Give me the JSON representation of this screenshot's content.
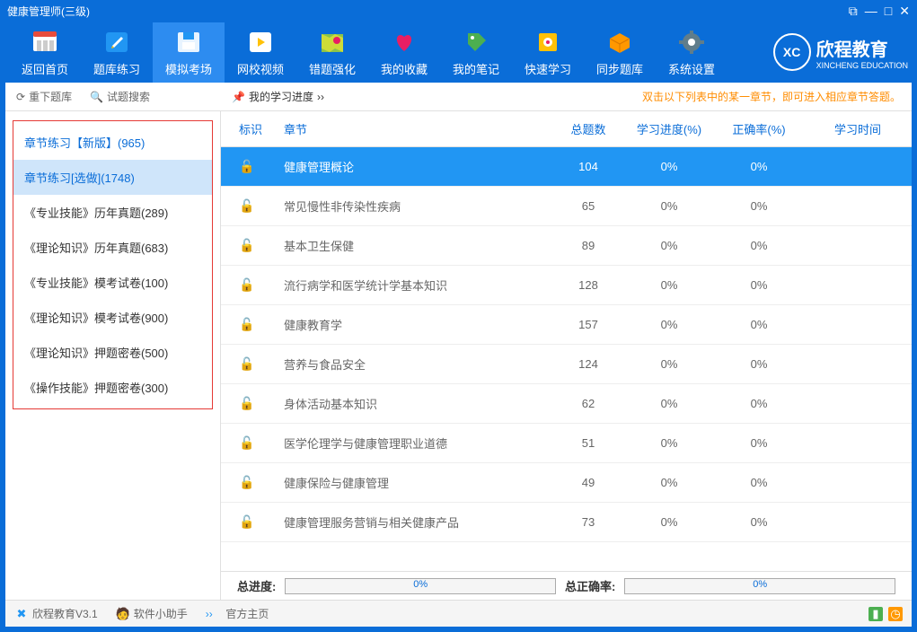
{
  "title": "健康管理师(三级)",
  "toolbar": [
    {
      "label": "返回首页"
    },
    {
      "label": "题库练习"
    },
    {
      "label": "模拟考场"
    },
    {
      "label": "网校视频"
    },
    {
      "label": "错题强化"
    },
    {
      "label": "我的收藏"
    },
    {
      "label": "我的笔记"
    },
    {
      "label": "快速学习"
    },
    {
      "label": "同步题库"
    },
    {
      "label": "系统设置"
    }
  ],
  "logo": {
    "cn": "欣程教育",
    "en": "XINCHENG EDUCATION",
    "abbr": "XC"
  },
  "subbar": {
    "reload": "重下题库",
    "search": "试题搜索",
    "progress": "我的学习进度",
    "hint": "双击以下列表中的某一章节，即可进入相应章节答题。"
  },
  "sidebar": [
    {
      "label": "章节练习【新版】(965)",
      "blue": true
    },
    {
      "label": "章节练习[选做](1748)",
      "selected": true
    },
    {
      "label": "《专业技能》历年真题(289)"
    },
    {
      "label": "《理论知识》历年真题(683)"
    },
    {
      "label": "《专业技能》模考试卷(100)"
    },
    {
      "label": "《理论知识》模考试卷(900)"
    },
    {
      "label": "《理论知识》押题密卷(500)"
    },
    {
      "label": "《操作技能》押题密卷(300)"
    }
  ],
  "columns": {
    "mark": "标识",
    "chapter": "章节",
    "total": "总题数",
    "progress": "学习进度(%)",
    "correct": "正确率(%)",
    "time": "学习时间"
  },
  "rows": [
    {
      "chapter": "健康管理概论",
      "total": "104",
      "progress": "0%",
      "correct": "0%",
      "hl": true
    },
    {
      "chapter": "常见慢性非传染性疾病",
      "total": "65",
      "progress": "0%",
      "correct": "0%"
    },
    {
      "chapter": "基本卫生保健",
      "total": "89",
      "progress": "0%",
      "correct": "0%"
    },
    {
      "chapter": "流行病学和医学统计学基本知识",
      "total": "128",
      "progress": "0%",
      "correct": "0%"
    },
    {
      "chapter": "健康教育学",
      "total": "157",
      "progress": "0%",
      "correct": "0%"
    },
    {
      "chapter": "营养与食品安全",
      "total": "124",
      "progress": "0%",
      "correct": "0%"
    },
    {
      "chapter": "身体活动基本知识",
      "total": "62",
      "progress": "0%",
      "correct": "0%"
    },
    {
      "chapter": "医学伦理学与健康管理职业道德",
      "total": "51",
      "progress": "0%",
      "correct": "0%"
    },
    {
      "chapter": "健康保险与健康管理",
      "total": "49",
      "progress": "0%",
      "correct": "0%"
    },
    {
      "chapter": "健康管理服务营销与相关健康产品",
      "total": "73",
      "progress": "0%",
      "correct": "0%"
    }
  ],
  "footer": {
    "total_progress_label": "总进度:",
    "total_progress_value": "0%",
    "total_correct_label": "总正确率:",
    "total_correct_value": "0%"
  },
  "statusbar": {
    "app": "欣程教育V3.1",
    "helper": "软件小助手",
    "home": "官方主页"
  }
}
